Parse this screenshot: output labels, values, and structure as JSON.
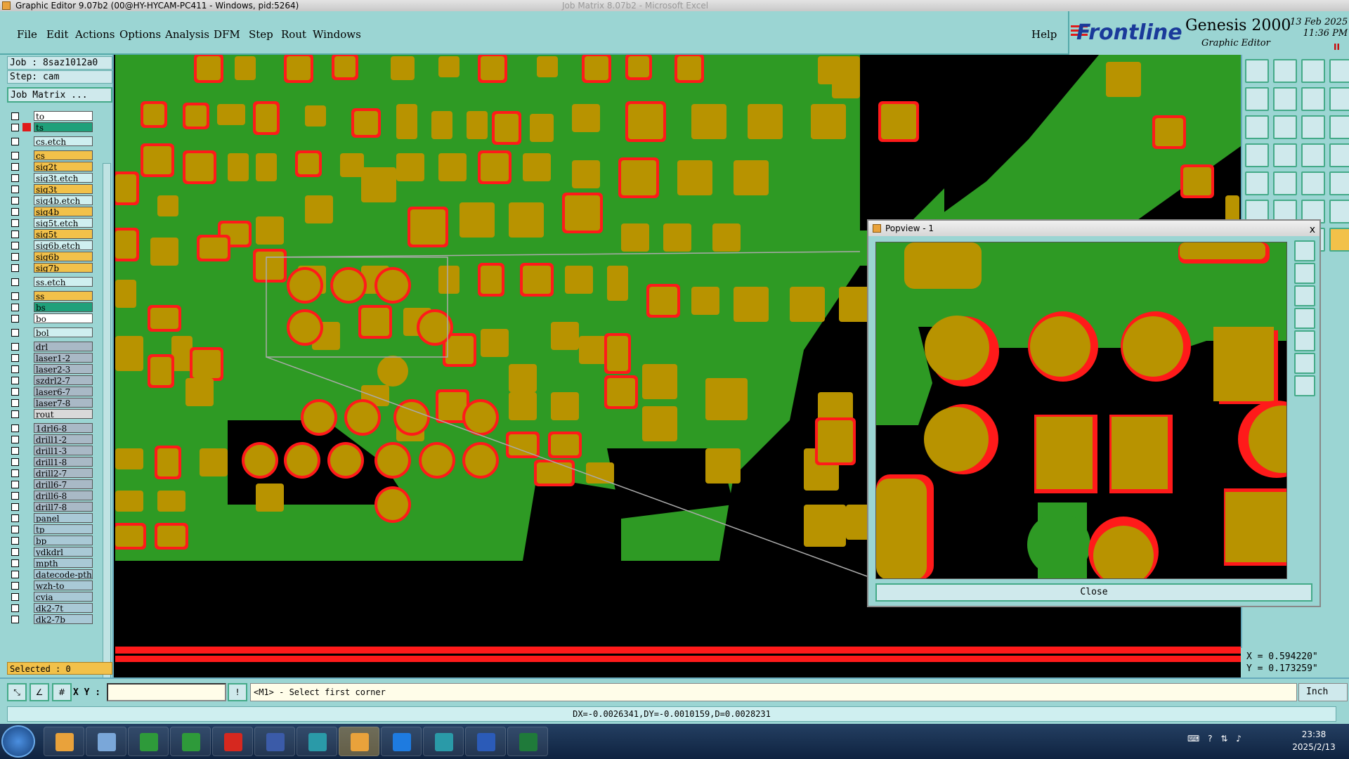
{
  "window": {
    "title": "Graphic Editor 9.07b2 (00@HY-HYCAM-PC411 - Windows, pid:5264)",
    "title_faded": "Job Matrix 8.07b2 - Microsoft Excel"
  },
  "menus": [
    "File",
    "Edit",
    "Actions",
    "Options",
    "Analysis",
    "DFM",
    "Step",
    "Rout",
    "Windows"
  ],
  "help_label": "Help",
  "brand": {
    "logo": "Frontline",
    "product": "Genesis 2000",
    "subtitle": "Graphic Editor",
    "date": "13 Feb 2025",
    "time": "11:36 PM",
    "indicator": "II"
  },
  "left": {
    "job": "Job : 8saz1012a0",
    "step": "Step: cam",
    "job_matrix_button": "Job Matrix ...",
    "selected": "Selected : 0"
  },
  "layers": [
    {
      "name": "to",
      "color": "#ffffff",
      "mark": ""
    },
    {
      "name": "ts",
      "color": "#1fa07a",
      "mark": "#e01a1a"
    },
    {
      "name": "cs.etch",
      "color": "#cfeff0",
      "mark": ""
    },
    {
      "name": "cs",
      "color": "#f2c14a",
      "mark": ""
    },
    {
      "name": "sig2t",
      "color": "#f2c14a",
      "mark": ""
    },
    {
      "name": "sig3t.etch",
      "color": "#cfeff0",
      "mark": ""
    },
    {
      "name": "sig3t",
      "color": "#f2c14a",
      "mark": ""
    },
    {
      "name": "sig4b.etch",
      "color": "#cfeff0",
      "mark": ""
    },
    {
      "name": "sig4b",
      "color": "#f2c14a",
      "mark": ""
    },
    {
      "name": "sig5t.etch",
      "color": "#cfeff0",
      "mark": ""
    },
    {
      "name": "sig5t",
      "color": "#f2c14a",
      "mark": ""
    },
    {
      "name": "sig6b.etch",
      "color": "#cfeff0",
      "mark": ""
    },
    {
      "name": "sig6b",
      "color": "#f2c14a",
      "mark": ""
    },
    {
      "name": "sig7b",
      "color": "#f2c14a",
      "mark": ""
    },
    {
      "name": "ss.etch",
      "color": "#cfeff0",
      "mark": ""
    },
    {
      "name": "ss",
      "color": "#f2c14a",
      "mark": ""
    },
    {
      "name": "bs",
      "color": "#1fa07a",
      "mark": ""
    },
    {
      "name": "bo",
      "color": "#ffffff",
      "mark": ""
    },
    {
      "name": "bol",
      "color": "#cfeff0",
      "mark": ""
    },
    {
      "name": "drl",
      "color": "#a9b9c6",
      "mark": ""
    },
    {
      "name": "laser1-2",
      "color": "#a9b9c6",
      "mark": ""
    },
    {
      "name": "laser2-3",
      "color": "#a9b9c6",
      "mark": ""
    },
    {
      "name": "szdrl2-7",
      "color": "#a9b9c6",
      "mark": ""
    },
    {
      "name": "laser6-7",
      "color": "#a9b9c6",
      "mark": ""
    },
    {
      "name": "laser7-8",
      "color": "#a9b9c6",
      "mark": ""
    },
    {
      "name": "rout",
      "color": "#d9d9d9",
      "mark": ""
    },
    {
      "name": "1drl6-8",
      "color": "#a9b9c6",
      "mark": ""
    },
    {
      "name": "drill1-2",
      "color": "#a9b9c6",
      "mark": ""
    },
    {
      "name": "drill1-3",
      "color": "#a9b9c6",
      "mark": ""
    },
    {
      "name": "drill1-8",
      "color": "#a9b9c6",
      "mark": ""
    },
    {
      "name": "drill2-7",
      "color": "#a9b9c6",
      "mark": ""
    },
    {
      "name": "drill6-7",
      "color": "#a9b9c6",
      "mark": ""
    },
    {
      "name": "drill6-8",
      "color": "#a9b9c6",
      "mark": ""
    },
    {
      "name": "drill7-8",
      "color": "#a9b9c6",
      "mark": ""
    },
    {
      "name": "panel",
      "color": "#a9c9d6",
      "mark": ""
    },
    {
      "name": "tp",
      "color": "#a9c9d6",
      "mark": ""
    },
    {
      "name": "bp",
      "color": "#a9c9d6",
      "mark": ""
    },
    {
      "name": "ydkdrl",
      "color": "#a9c9d6",
      "mark": ""
    },
    {
      "name": "mpth",
      "color": "#a9c9d6",
      "mark": ""
    },
    {
      "name": "datecode-pth",
      "color": "#a9c9d6",
      "mark": ""
    },
    {
      "name": "wzh-to",
      "color": "#a9c9d6",
      "mark": ""
    },
    {
      "name": "cvia",
      "color": "#a9c9d6",
      "mark": ""
    },
    {
      "name": "dk2-7t",
      "color": "#a9c9d6",
      "mark": ""
    },
    {
      "name": "dk2-7b",
      "color": "#a9c9d6",
      "mark": ""
    }
  ],
  "coords": {
    "x": "X = 0.594220\"",
    "y": "Y = 0.173259\""
  },
  "status": {
    "xy_label": "X Y :",
    "xy_value": "",
    "prompt": "<M1> - Select first corner",
    "units": "Inch",
    "measure": "DX=-0.0026341,DY=-0.0010159,D=0.0028231"
  },
  "popview": {
    "title": "Popview - 1",
    "close_x": "x",
    "close_label": "Close"
  },
  "taskbar": {
    "time": "23:38",
    "date": "2025/2/13"
  },
  "colors": {
    "panel": "#9bd5d3",
    "copper": "#2e9a24",
    "pad": "#b89300",
    "pad_edge": "#ff1a1a",
    "background": "#000000"
  }
}
